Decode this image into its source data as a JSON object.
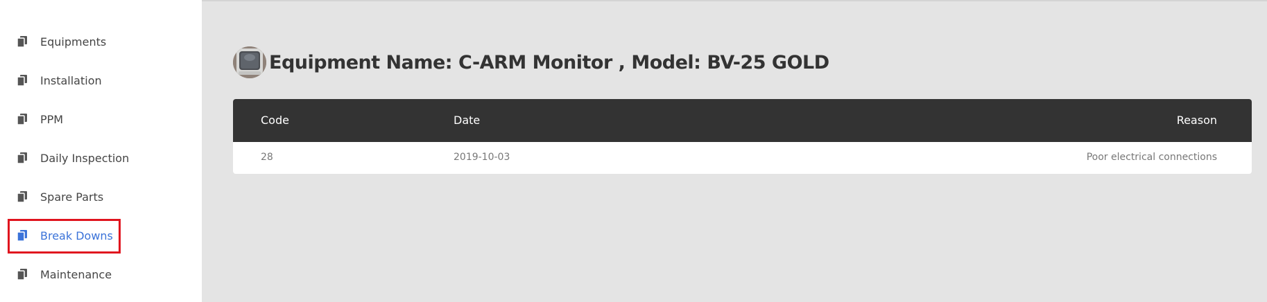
{
  "sidebar": {
    "items": [
      {
        "label": "Equipments",
        "icon": "document-copy-icon",
        "active": false
      },
      {
        "label": "Installation",
        "icon": "document-copy-icon",
        "active": false
      },
      {
        "label": "PPM",
        "icon": "document-copy-icon",
        "active": false
      },
      {
        "label": "Daily Inspection",
        "icon": "document-copy-icon",
        "active": false
      },
      {
        "label": "Spare Parts",
        "icon": "document-copy-icon",
        "active": false
      },
      {
        "label": "Break Downs",
        "icon": "document-copy-icon",
        "active": true
      },
      {
        "label": "Maintenance",
        "icon": "document-copy-icon",
        "active": false
      }
    ]
  },
  "main": {
    "title": "Equipment Name: C-ARM Monitor , Model: BV-25 GOLD",
    "table": {
      "headers": {
        "code": "Code",
        "date": "Date",
        "reason": "Reason"
      },
      "rows": [
        {
          "code": "28",
          "date": "2019-10-03",
          "reason": "Poor electrical connections"
        }
      ]
    }
  },
  "colors": {
    "active": "#3b73d9",
    "highlight": "#e0141e",
    "table_header": "#333333",
    "background": "#e4e4e4"
  }
}
